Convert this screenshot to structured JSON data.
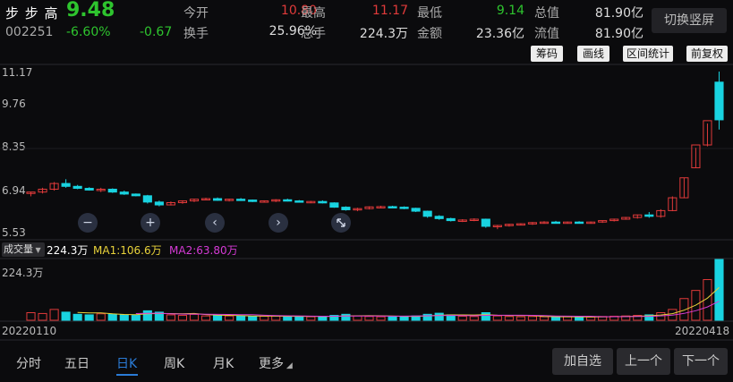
{
  "header": {
    "name": "步 步 高",
    "price": "9.48",
    "code": "002251",
    "change_pct": "-6.60%",
    "change": "-0.67",
    "stats": [
      {
        "label": "今开",
        "value": "10.80",
        "color": "#e03a3a"
      },
      {
        "label": "最高",
        "value": "11.17",
        "color": "#e03a3a"
      },
      {
        "label": "最低",
        "value": "9.14",
        "color": "#2ec42e"
      },
      {
        "label": "总值",
        "value": "81.90亿",
        "color": "#dddddd"
      },
      {
        "label": "换手",
        "value": "25.96%",
        "color": "#dddddd"
      },
      {
        "label": "总手",
        "value": "224.3万",
        "color": "#dddddd"
      },
      {
        "label": "金额",
        "value": "23.36亿",
        "color": "#dddddd"
      },
      {
        "label": "流值",
        "value": "81.90亿",
        "color": "#dddddd"
      }
    ],
    "switch_label": "切换竖屏"
  },
  "toolbar": {
    "chips": "筹码",
    "line": "画线",
    "interval": "区间统计",
    "adjust": "前复权"
  },
  "price_axis": [
    "11.17",
    "9.76",
    "8.35",
    "6.94",
    "5.53"
  ],
  "controls": {
    "zoom_out": "−",
    "zoom_in": "+",
    "prev": "‹",
    "next": "›"
  },
  "volume": {
    "selector": "成交量",
    "value": "224.3万",
    "ma1": "MA1:106.6万",
    "ma2": "MA2:63.80万",
    "axis_label": "224.3万"
  },
  "dates": {
    "start": "20220110",
    "end": "20220418"
  },
  "tabs": [
    "分时",
    "五日",
    "日K",
    "周K",
    "月K",
    "更多"
  ],
  "buttons": {
    "watch": "加自选",
    "prev": "上一个",
    "next": "下一个"
  },
  "colors": {
    "up": "#e03a3a",
    "down": "#19d3e0",
    "green": "#2ec42e",
    "accent": "#2a7bd6"
  },
  "chart_data": {
    "type": "candlestick",
    "title": "",
    "ylim": [
      5.53,
      11.17
    ],
    "candles": [
      [
        6.9,
        6.95,
        6.8,
        6.95
      ],
      [
        6.95,
        7.1,
        6.9,
        7.05
      ],
      [
        7.05,
        7.3,
        7.0,
        7.25
      ],
      [
        7.25,
        7.4,
        7.1,
        7.15
      ],
      [
        7.15,
        7.2,
        7.05,
        7.08
      ],
      [
        7.08,
        7.12,
        7.0,
        7.02
      ],
      [
        7.02,
        7.1,
        6.95,
        7.05
      ],
      [
        7.05,
        7.08,
        6.92,
        6.95
      ],
      [
        6.95,
        7.0,
        6.85,
        6.88
      ],
      [
        6.88,
        6.9,
        6.8,
        6.82
      ],
      [
        6.82,
        6.85,
        6.55,
        6.6
      ],
      [
        6.6,
        6.65,
        6.45,
        6.5
      ],
      [
        6.5,
        6.62,
        6.48,
        6.58
      ],
      [
        6.58,
        6.66,
        6.54,
        6.64
      ],
      [
        6.64,
        6.72,
        6.6,
        6.7
      ],
      [
        6.7,
        6.75,
        6.66,
        6.72
      ],
      [
        6.72,
        6.76,
        6.64,
        6.66
      ],
      [
        6.66,
        6.72,
        6.62,
        6.7
      ],
      [
        6.7,
        6.74,
        6.64,
        6.67
      ],
      [
        6.67,
        6.69,
        6.6,
        6.62
      ],
      [
        6.62,
        6.66,
        6.58,
        6.64
      ],
      [
        6.64,
        6.7,
        6.6,
        6.68
      ],
      [
        6.68,
        6.72,
        6.62,
        6.64
      ],
      [
        6.64,
        6.67,
        6.58,
        6.6
      ],
      [
        6.6,
        6.64,
        6.56,
        6.62
      ],
      [
        6.62,
        6.66,
        6.55,
        6.57
      ],
      [
        6.57,
        6.59,
        6.4,
        6.42
      ],
      [
        6.42,
        6.45,
        6.3,
        6.33
      ],
      [
        6.33,
        6.4,
        6.28,
        6.37
      ],
      [
        6.37,
        6.45,
        6.34,
        6.43
      ],
      [
        6.43,
        6.47,
        6.38,
        6.44
      ],
      [
        6.44,
        6.47,
        6.4,
        6.42
      ],
      [
        6.42,
        6.45,
        6.35,
        6.38
      ],
      [
        6.38,
        6.4,
        6.25,
        6.28
      ],
      [
        6.28,
        6.3,
        6.05,
        6.1
      ],
      [
        6.1,
        6.14,
        5.98,
        6.02
      ],
      [
        6.02,
        6.05,
        5.92,
        5.95
      ],
      [
        5.95,
        6.0,
        5.9,
        5.97
      ],
      [
        5.97,
        6.03,
        5.93,
        6.0
      ],
      [
        6.0,
        6.02,
        5.7,
        5.75
      ],
      [
        5.75,
        5.8,
        5.65,
        5.78
      ],
      [
        5.78,
        5.84,
        5.74,
        5.82
      ],
      [
        5.82,
        5.86,
        5.78,
        5.84
      ],
      [
        5.84,
        5.9,
        5.8,
        5.88
      ],
      [
        5.88,
        5.93,
        5.84,
        5.9
      ],
      [
        5.9,
        5.94,
        5.85,
        5.88
      ],
      [
        5.88,
        5.92,
        5.84,
        5.9
      ],
      [
        5.9,
        5.93,
        5.86,
        5.87
      ],
      [
        5.87,
        5.92,
        5.84,
        5.9
      ],
      [
        5.9,
        5.96,
        5.87,
        5.95
      ],
      [
        5.95,
        6.02,
        5.92,
        6.0
      ],
      [
        6.0,
        6.08,
        5.98,
        6.06
      ],
      [
        6.06,
        6.16,
        6.02,
        6.15
      ],
      [
        6.15,
        6.25,
        6.05,
        6.1
      ],
      [
        6.1,
        6.35,
        6.05,
        6.3
      ],
      [
        6.3,
        6.8,
        6.28,
        6.75
      ],
      [
        6.75,
        7.45,
        6.75,
        7.45
      ],
      [
        7.8,
        8.5,
        7.8,
        8.6
      ],
      [
        8.6,
        9.35,
        8.55,
        9.45
      ],
      [
        10.8,
        11.17,
        9.14,
        9.48
      ]
    ],
    "volume": [
      28,
      25,
      40,
      30,
      22,
      20,
      24,
      22,
      20,
      18,
      35,
      30,
      20,
      18,
      22,
      16,
      18,
      16,
      15,
      14,
      15,
      16,
      14,
      14,
      13,
      14,
      18,
      22,
      16,
      14,
      13,
      14,
      15,
      16,
      22,
      26,
      20,
      15,
      14,
      28,
      16,
      14,
      13,
      14,
      13,
      12,
      13,
      12,
      12,
      14,
      15,
      16,
      18,
      20,
      28,
      40,
      80,
      110,
      150,
      224.3
    ],
    "volume_max": 224.3
  }
}
